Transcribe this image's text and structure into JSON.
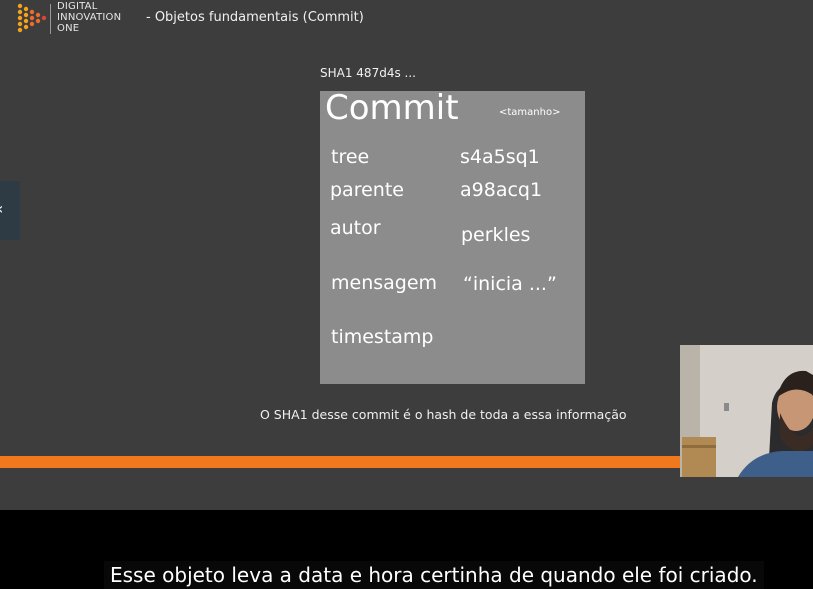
{
  "header": {
    "brand_lines": [
      "DIGITAL",
      "INNOVATION",
      "ONE"
    ],
    "slide_title": "- Objetos fundamentais (Commit)"
  },
  "slide": {
    "sha_label": "SHA1 487d4s ...",
    "card": {
      "title": "Commit",
      "size_tag": "<tamanho>",
      "fields": [
        {
          "name": "tree",
          "value": "s4a5sq1"
        },
        {
          "name": "parente",
          "value": "a98acq1"
        },
        {
          "name": "autor",
          "value": "perkles"
        },
        {
          "name": "mensagem",
          "value": "“inicia ...”"
        },
        {
          "name": "timestamp",
          "value": ""
        }
      ]
    },
    "note": "O SHA1 desse commit é o hash de toda a essa informação"
  },
  "player": {
    "side_tab_glyph": "‹",
    "progress_fraction": 0.836,
    "caption": "Esse objeto leva a data e hora certinha de quando ele foi criado."
  },
  "colors": {
    "background": "#3d3d3d",
    "card": "#8c8c8c",
    "progress": "#f0791e",
    "caption_bar": "#000000"
  }
}
